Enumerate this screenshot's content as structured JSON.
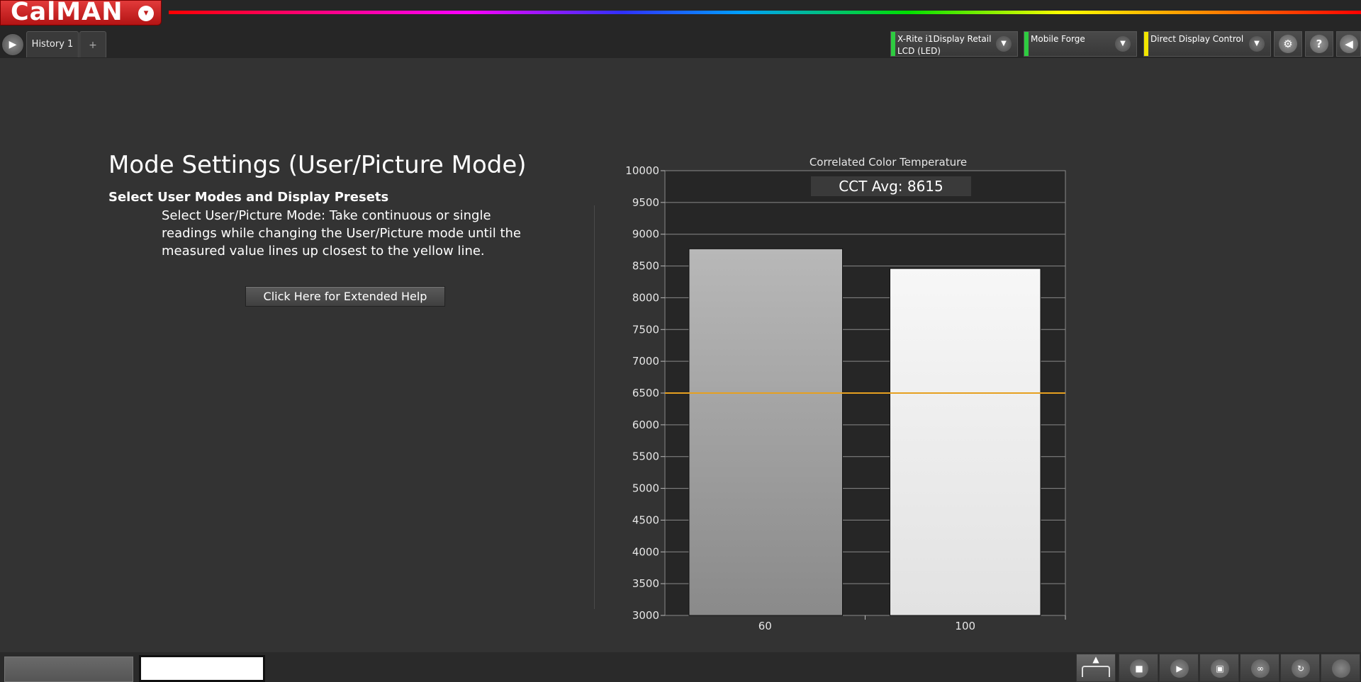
{
  "app": {
    "logo": "CalMAN",
    "logo_dropdown": "▾"
  },
  "tabs": [
    {
      "label": "History 1"
    }
  ],
  "tab_add_label": "+",
  "nav_arrow": "▶",
  "devices": [
    {
      "label_line1": "X-Rite i1Display Retail",
      "label_line2": "LCD (LED)",
      "status_color": "#2ecc40"
    },
    {
      "label_line1": "Mobile Forge",
      "label_line2": "",
      "status_color": "#2ecc40"
    },
    {
      "label_line1": "Direct Display Control",
      "label_line2": "",
      "status_color": "#f2e600"
    }
  ],
  "toolbar": {
    "settings_icon": "gear-icon",
    "help_label": "?",
    "collapse_icon": "◀"
  },
  "content": {
    "title": "Mode Settings (User/Picture Mode)",
    "subtitle": "Select User Modes and Display Presets",
    "description": "Select User/Picture Mode: Take continuous or single readings while changing the User/Picture mode until the measured value lines up closest to the yellow line.",
    "help_button": "Click Here for Extended Help"
  },
  "chart_data": {
    "type": "bar",
    "title": "Correlated Color Temperature",
    "annotation": "CCT Avg: 8615",
    "categories": [
      "60",
      "100"
    ],
    "values": [
      8770,
      8460
    ],
    "reference_line": 6500,
    "ylim": [
      3000,
      10000
    ],
    "yticks": [
      10000,
      9500,
      9000,
      8500,
      8000,
      7500,
      7000,
      6500,
      6000,
      5500,
      5000,
      4500,
      4000,
      3500,
      3000
    ],
    "grid": true,
    "colors": {
      "bar_60": "#9a9a9a",
      "bar_100": "#f2f2f2",
      "reference": "#e6a020",
      "plot_bg": "#262626"
    }
  },
  "bottom_controls": [
    "up-arrow-icon",
    "stop-icon",
    "play-icon",
    "save-icon",
    "continuous-icon",
    "refresh-icon",
    "record-icon"
  ]
}
